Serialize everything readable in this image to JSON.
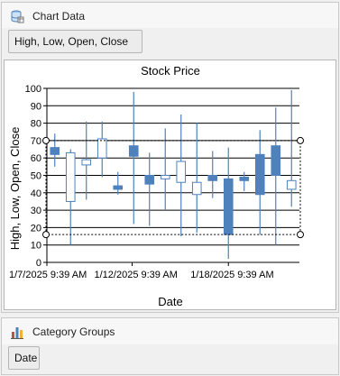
{
  "chart_data_panel": {
    "title": "Chart Data",
    "icon": "database-icon",
    "value_field": "High, Low, Open, Close"
  },
  "category_groups_panel": {
    "title": "Category Groups",
    "icon": "bar-chart-icon",
    "field": "Date"
  },
  "chart_data": {
    "type": "candlestick",
    "title": "Stock Price",
    "xlabel": "Date",
    "ylabel": "High, Low, Open, Close",
    "ylim": [
      0,
      100
    ],
    "yticks": [
      0,
      10,
      20,
      30,
      40,
      50,
      60,
      70,
      80,
      90,
      100
    ],
    "xtick_labels": [
      "1/7/2025 9:39 AM",
      "1/12/2025 9:39 AM",
      "1/18/2025 9:39 AM"
    ],
    "grid": true,
    "colors": {
      "up": "#ffffff",
      "down": "#4f81bd",
      "wick": "#4f81bd",
      "selection": "#000000"
    },
    "candles": [
      {
        "open": 66,
        "close": 62,
        "high": 74,
        "low": 55
      },
      {
        "open": 35,
        "close": 63,
        "high": 65,
        "low": 10
      },
      {
        "open": 56,
        "close": 59,
        "high": 81,
        "low": 36
      },
      {
        "open": 60,
        "close": 71,
        "high": 81,
        "low": 49
      },
      {
        "open": 44,
        "close": 42,
        "high": 52,
        "low": 39
      },
      {
        "open": 67,
        "close": 61,
        "high": 98,
        "low": 22
      },
      {
        "open": 50,
        "close": 45,
        "high": 63,
        "low": 21
      },
      {
        "open": 48,
        "close": 50,
        "high": 77,
        "low": 30
      },
      {
        "open": 46,
        "close": 58,
        "high": 85,
        "low": 15
      },
      {
        "open": 39,
        "close": 46,
        "high": 80,
        "low": 17
      },
      {
        "open": 50,
        "close": 47,
        "high": 64,
        "low": 37
      },
      {
        "open": 48,
        "close": 16,
        "high": 66,
        "low": 2
      },
      {
        "open": 49,
        "close": 47,
        "high": 52,
        "low": 41
      },
      {
        "open": 62,
        "close": 39,
        "high": 76,
        "low": 16
      },
      {
        "open": 67,
        "close": 50,
        "high": 89,
        "low": 10
      },
      {
        "open": 42,
        "close": 47,
        "high": 99,
        "low": 32
      }
    ],
    "selection": {
      "low": 16,
      "high": 70
    }
  }
}
